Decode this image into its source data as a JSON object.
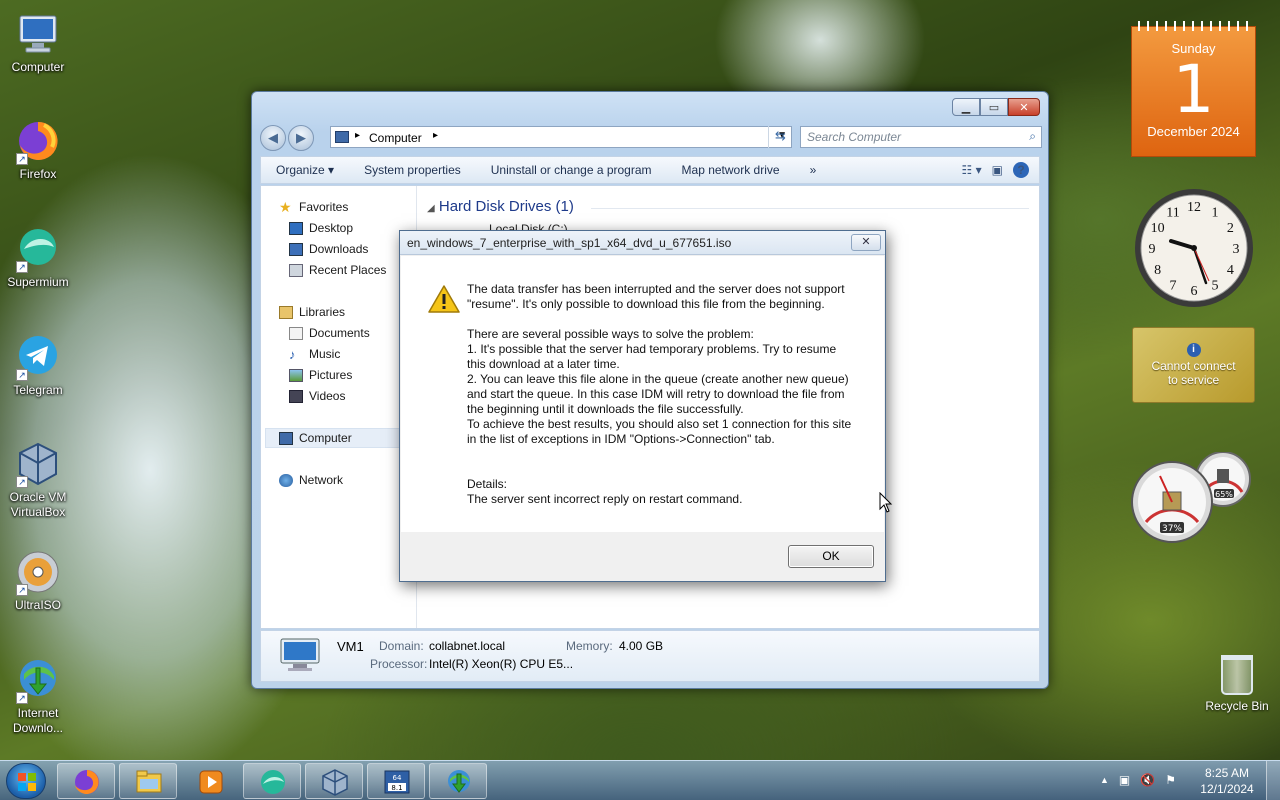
{
  "desktop": {
    "icons": [
      {
        "label": "Computer",
        "icon": "computer-icon"
      },
      {
        "label": "Firefox",
        "icon": "firefox-icon"
      },
      {
        "label": "Supermium",
        "icon": "supermium-icon"
      },
      {
        "label": "Telegram",
        "icon": "telegram-icon"
      },
      {
        "label": "Oracle VM VirtualBox",
        "icon": "virtualbox-icon"
      },
      {
        "label": "UltraISO",
        "icon": "ultraiso-icon"
      },
      {
        "label": "Internet Downlo...",
        "icon": "idm-icon"
      }
    ],
    "recycle_bin": "Recycle Bin"
  },
  "explorer": {
    "address": "Computer",
    "search_placeholder": "Search Computer",
    "toolbar": {
      "organize": "Organize",
      "system_properties": "System properties",
      "uninstall": "Uninstall or change a program",
      "map_drive": "Map network drive",
      "more": "»"
    },
    "nav": {
      "favorites": "Favorites",
      "desktop": "Desktop",
      "downloads": "Downloads",
      "recent_places": "Recent Places",
      "libraries": "Libraries",
      "documents": "Documents",
      "music": "Music",
      "pictures": "Pictures",
      "videos": "Videos",
      "computer": "Computer",
      "network": "Network"
    },
    "section_title": "Hard Disk Drives (1)",
    "partial_drive_label": "Local Disk (C:)",
    "details": {
      "name": "VM1",
      "domain_label": "Domain:",
      "domain_value": "collabnet.local",
      "memory_label": "Memory:",
      "memory_value": "4.00 GB",
      "processor_label": "Processor:",
      "processor_value": "Intel(R) Xeon(R) CPU E5..."
    }
  },
  "dialog": {
    "title": "en_windows_7_enterprise_with_sp1_x64_dvd_u_677651.iso",
    "line1": "The data transfer has been interrupted and the server does not support",
    "line2": "\"resume\". It's only possible to download this file from the beginning.",
    "line3": "There are several possible ways to solve the problem:",
    "line4": "1. It's possible that the server had temporary problems. Try to resume",
    "line5": "this download at a later time.",
    "line6": "2. You can leave this file alone in the queue (create another new queue)",
    "line7": "and start the queue. In this case IDM will retry to download the file from",
    "line8": "the beginning until it downloads the file successfully.",
    "line9": "To achieve the best results, you should also set 1 connection for this site",
    "line10": "in the list of exceptions in IDM \"Options->Connection\" tab.",
    "details_label": "Details:",
    "details_text": "The server sent incorrect reply on restart command.",
    "ok": "OK"
  },
  "gadgets": {
    "calendar": {
      "weekday": "Sunday",
      "day": "1",
      "month_year": "December 2024"
    },
    "clock_numbers": [
      "12",
      "1",
      "2",
      "3",
      "4",
      "5",
      "6",
      "7",
      "8",
      "9",
      "10",
      "11"
    ],
    "weather_message": "Cannot connect to service",
    "cpu_percent": "37%",
    "memory_percent": "65%"
  },
  "taskbar": {
    "time": "8:25 AM",
    "date": "12/1/2024",
    "tray_expand": "▲",
    "pinned": [
      "firefox",
      "explorer",
      "media-player",
      "supermium",
      "virtualbox",
      "ultraiso",
      "idm"
    ]
  }
}
